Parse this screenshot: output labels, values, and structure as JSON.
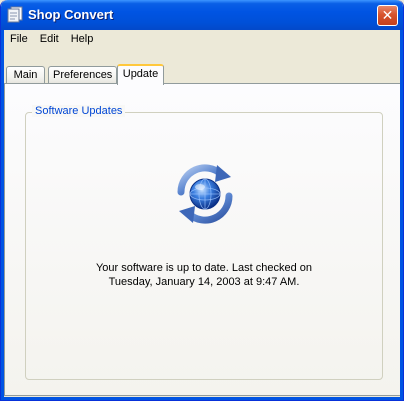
{
  "window": {
    "title": "Shop Convert",
    "close_symbol": "✕"
  },
  "menu": [
    {
      "label": "File"
    },
    {
      "label": "Edit"
    },
    {
      "label": "Help"
    }
  ],
  "tabs": [
    {
      "label": "Main",
      "active": false
    },
    {
      "label": "Preferences",
      "active": false
    },
    {
      "label": "Update",
      "active": true
    }
  ],
  "update_panel": {
    "group_title": "Software Updates",
    "status_line1": "Your software is up to date. Last checked on",
    "status_line2": "Tuesday, January 14, 2003 at 9:47 AM.",
    "icon": "refresh-globe-icon"
  },
  "colors": {
    "titlebar": "#0054e3",
    "active_tab_highlight": "#ffc83c",
    "group_title": "#0046d5"
  }
}
